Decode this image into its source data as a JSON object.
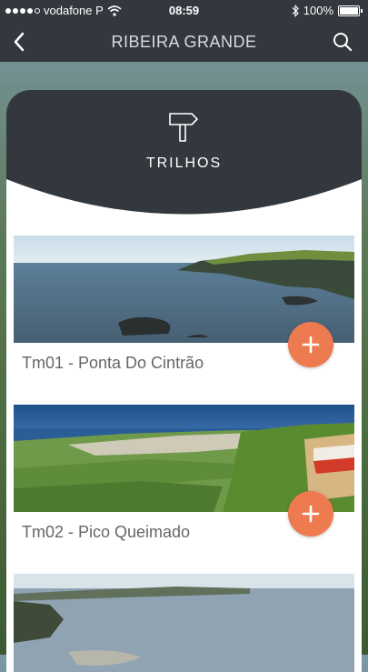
{
  "status_bar": {
    "carrier": "vodafone P",
    "time": "08:59",
    "battery": "100%"
  },
  "nav": {
    "title": "RIBEIRA GRANDE",
    "back_icon": "chevron-left-icon",
    "search_icon": "search-icon"
  },
  "section": {
    "title": "TRILHOS",
    "icon": "signpost-icon"
  },
  "trails": [
    {
      "name": "Tm01 - Ponta Do Cintrão"
    },
    {
      "name": "Tm02 - Pico Queimado"
    }
  ],
  "colors": {
    "nav_bg": "#32383e",
    "header_bg": "#32383e",
    "accent": "#ee7a50"
  }
}
